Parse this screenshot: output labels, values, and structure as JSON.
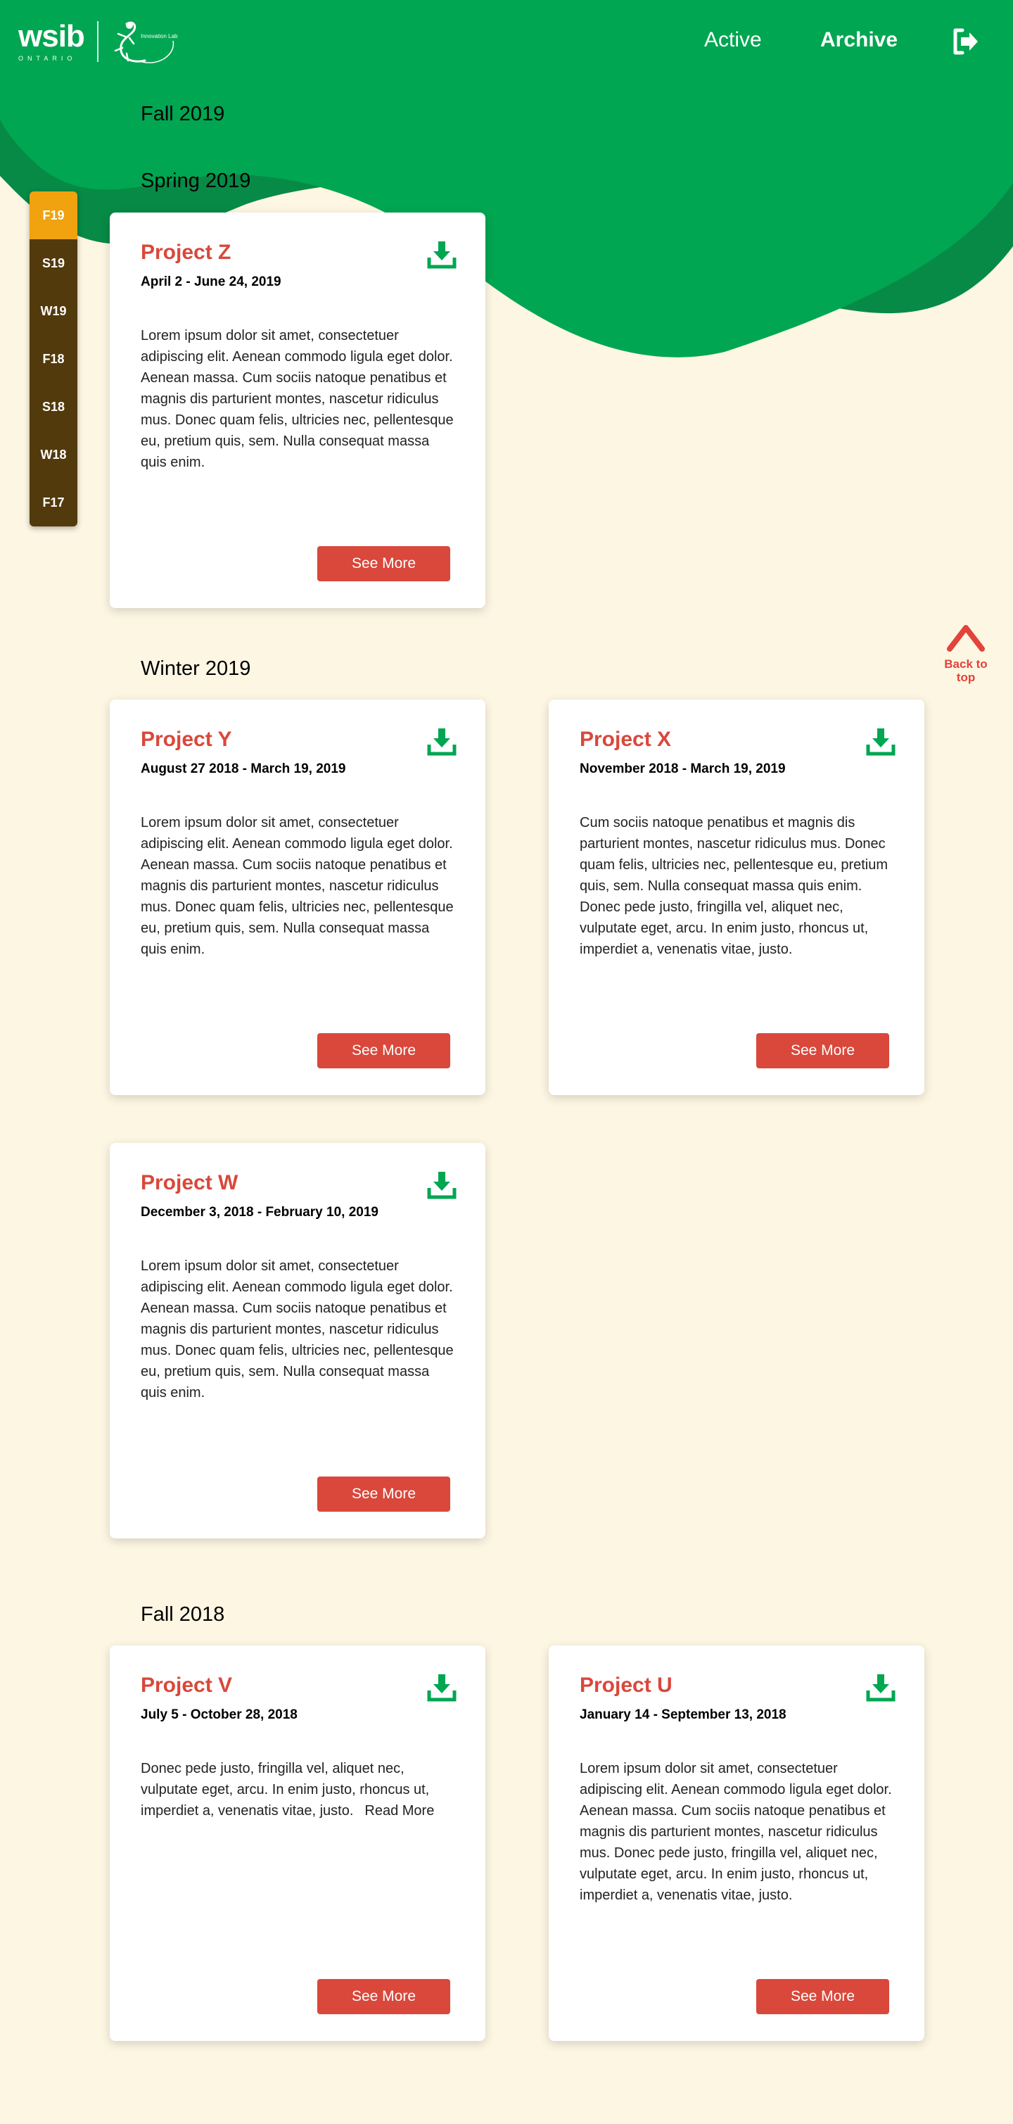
{
  "colors": {
    "brand_green": "#00a651",
    "dark_green": "#078a46",
    "background": "#fdf6e3",
    "accent_red": "#d9483b",
    "sidebar_brown": "#523a0c",
    "sidebar_selected": "#f0a20f"
  },
  "header": {
    "logo_word": "wsib",
    "logo_sub": "ONTARIO",
    "lab_text": "Innovation Lab",
    "nav": {
      "active": "Active",
      "archive": "Archive"
    },
    "logout_icon": "logout-icon"
  },
  "sidebar": {
    "items": [
      {
        "label": "F19",
        "selected": true
      },
      {
        "label": "S19",
        "selected": false
      },
      {
        "label": "W19",
        "selected": false
      },
      {
        "label": "F18",
        "selected": false
      },
      {
        "label": "S18",
        "selected": false
      },
      {
        "label": "W18",
        "selected": false
      },
      {
        "label": "F17",
        "selected": false
      }
    ]
  },
  "sections": {
    "fall2019": "Fall 2019",
    "spring2019": "Spring 2019",
    "winter2019": "Winter 2019",
    "fall2018": "Fall 2018"
  },
  "projects": [
    {
      "title": "Project Z",
      "dates": "April 2 - June 24, 2019",
      "body": "Lorem ipsum dolor sit amet, consectetuer adipiscing elit. Aenean commodo ligula eget dolor. Aenean massa. Cum sociis natoque penatibus et magnis dis parturient montes, nascetur ridiculus mus. Donec quam felis, ultricies nec, pellentesque eu, pretium quis, sem. Nulla consequat massa quis enim.",
      "see_more": "See More"
    },
    {
      "title": "Project Y",
      "dates": "August 27 2018 - March 19, 2019",
      "body": "Lorem ipsum dolor sit amet, consectetuer adipiscing elit. Aenean commodo ligula eget dolor. Aenean massa. Cum sociis natoque penatibus et magnis dis parturient montes, nascetur ridiculus mus. Donec quam felis, ultricies nec, pellentesque eu, pretium quis, sem. Nulla consequat massa quis enim.",
      "see_more": "See More"
    },
    {
      "title": "Project X",
      "dates": "November 2018 - March 19, 2019",
      "body": "Cum sociis natoque penatibus et magnis dis parturient montes, nascetur ridiculus mus. Donec quam felis, ultricies nec, pellentesque eu, pretium quis, sem. Nulla consequat massa quis enim. Donec pede justo, fringilla vel, aliquet nec, vulputate eget, arcu. In enim justo, rhoncus ut, imperdiet a, venenatis vitae, justo.",
      "see_more": "See More"
    },
    {
      "title": "Project W",
      "dates": "December 3, 2018 - February 10, 2019",
      "body": "Lorem ipsum dolor sit amet, consectetuer adipiscing elit. Aenean commodo ligula eget dolor. Aenean massa. Cum sociis natoque penatibus et magnis dis parturient montes, nascetur ridiculus mus. Donec quam felis, ultricies nec, pellentesque eu, pretium quis, sem. Nulla consequat massa quis enim.",
      "see_more": "See More"
    },
    {
      "title": "Project V",
      "dates": "July 5 - October 28, 2018",
      "body": "Donec pede justo, fringilla vel, aliquet nec, vulputate eget, arcu. In enim justo, rhoncus ut, imperdiet a, venenatis vitae, justo.",
      "read_more": "Read More",
      "see_more": "See More"
    },
    {
      "title": "Project U",
      "dates": "January 14 - September 13, 2018",
      "body": "Lorem ipsum dolor sit amet, consectetuer adipiscing elit. Aenean commodo ligula eget dolor. Aenean massa. Cum sociis natoque penatibus et magnis dis parturient montes, nascetur ridiculus mus. Donec pede justo, fringilla vel, aliquet nec, vulputate eget, arcu. In enim justo, rhoncus ut, imperdiet a, venenatis vitae, justo.",
      "see_more": "See More"
    }
  ],
  "back_to_top": {
    "label": "Back to top",
    "icon": "chevron-up-icon"
  },
  "download_icon": "download-icon"
}
